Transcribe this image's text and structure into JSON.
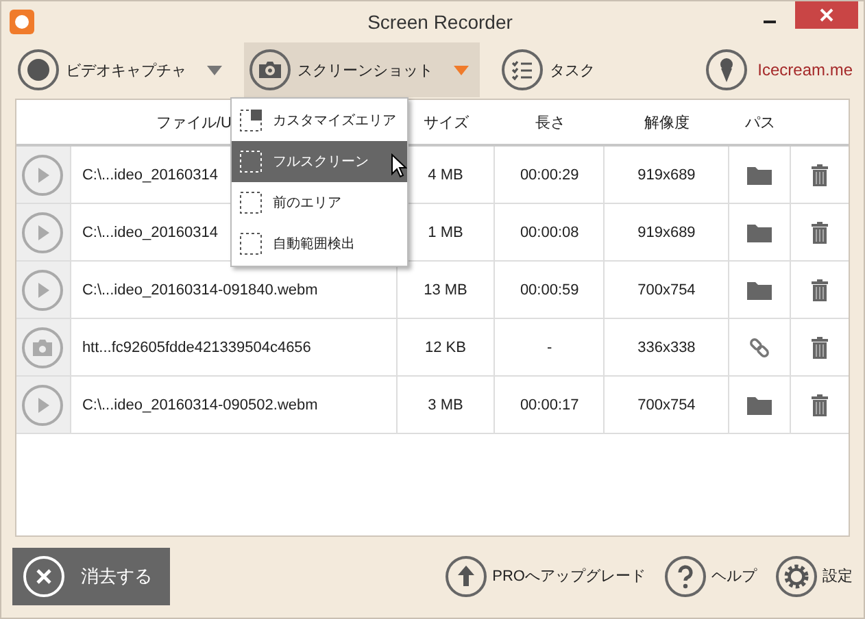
{
  "window": {
    "title": "Screen Recorder"
  },
  "toolbar": [
    {
      "kind": "video",
      "label": "ビデオキャプチャ",
      "selected": false
    },
    {
      "kind": "screenshot",
      "label": "スクリーンショット",
      "selected": true
    },
    {
      "kind": "tasks",
      "label": "タスク",
      "selected": false
    }
  ],
  "brand_link": "Icecream.me",
  "screenshot_menu": [
    {
      "kind": "custom",
      "label": "カスタマイズエリア",
      "selected": false
    },
    {
      "kind": "full",
      "label": "フルスクリーン",
      "selected": true
    },
    {
      "kind": "previous",
      "label": "前のエリア",
      "selected": false
    },
    {
      "kind": "auto",
      "label": "自動範囲検出",
      "selected": false
    }
  ],
  "table": {
    "columns": [
      "ファイル/U",
      "サイズ",
      "長さ",
      "解像度",
      "パス"
    ],
    "rows": [
      {
        "kind": "video",
        "file": "C:\\...ideo_20160314",
        "size": "4 MB",
        "length": "00:00:29",
        "resolution": "919x689",
        "path": {
          "kind": "folder"
        }
      },
      {
        "kind": "video",
        "file": "C:\\...ideo_20160314",
        "size": "1 MB",
        "length": "00:00:08",
        "resolution": "919x689",
        "path": {
          "kind": "folder"
        }
      },
      {
        "kind": "video",
        "file": "C:\\...ideo_20160314-091840.webm",
        "size": "13 MB",
        "length": "00:00:59",
        "resolution": "700x754",
        "path": {
          "kind": "folder"
        }
      },
      {
        "kind": "screenshot",
        "file": "htt...fc92605fdde421339504c4656",
        "size": "12 KB",
        "length": "-",
        "resolution": "336x338",
        "path": {
          "kind": "link"
        }
      },
      {
        "kind": "video",
        "file": "C:\\...ideo_20160314-090502.webm",
        "size": "3 MB",
        "length": "00:00:17",
        "resolution": "700x754",
        "path": {
          "kind": "folder"
        }
      }
    ]
  },
  "clear_button": "消去する",
  "footer": [
    {
      "kind": "upgrade",
      "label": "PROへアップグレード"
    },
    {
      "kind": "help",
      "label": "ヘルプ"
    },
    {
      "kind": "settings",
      "label": "設定"
    }
  ]
}
